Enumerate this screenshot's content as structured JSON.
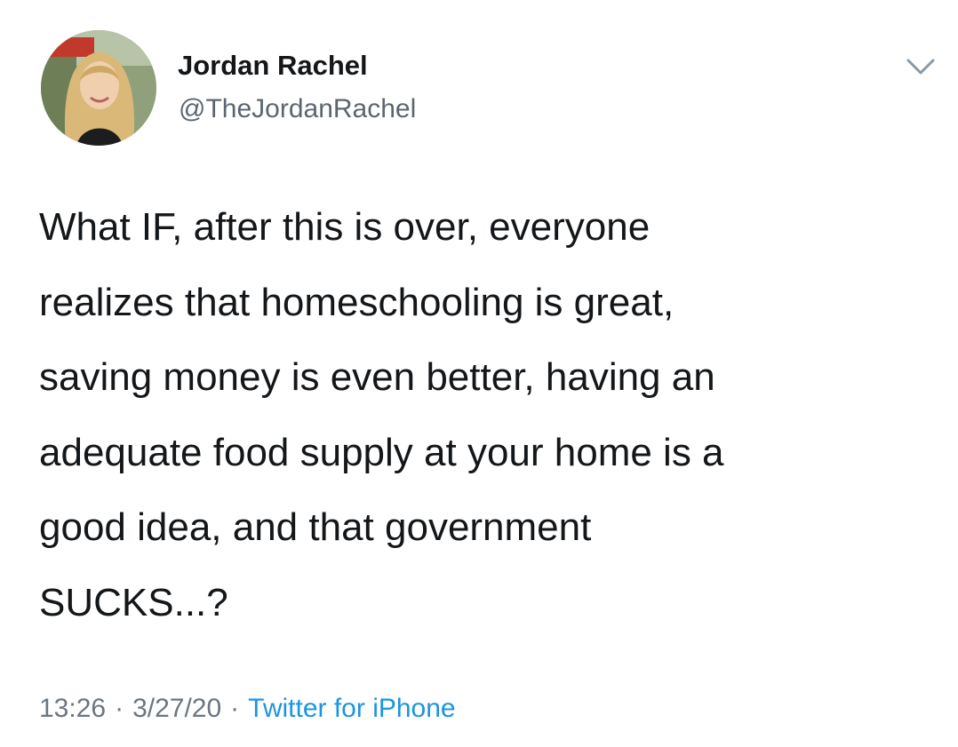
{
  "author": {
    "display_name": "Jordan Rachel",
    "handle": "@TheJordanRachel"
  },
  "tweet": {
    "lines": [
      "What IF, after this is over, everyone",
      "realizes that homeschooling is great,",
      "saving money is even better, having an",
      "adequate food supply at your home is a",
      "good idea, and that government",
      "SUCKS...?"
    ]
  },
  "meta": {
    "time": "13:26",
    "separator": "·",
    "date": "3/27/20",
    "source": "Twitter for iPhone"
  },
  "icons": {
    "menu": "chevron-down-icon"
  },
  "colors": {
    "link": "#1b95e0",
    "secondary_text": "#6b7680"
  }
}
